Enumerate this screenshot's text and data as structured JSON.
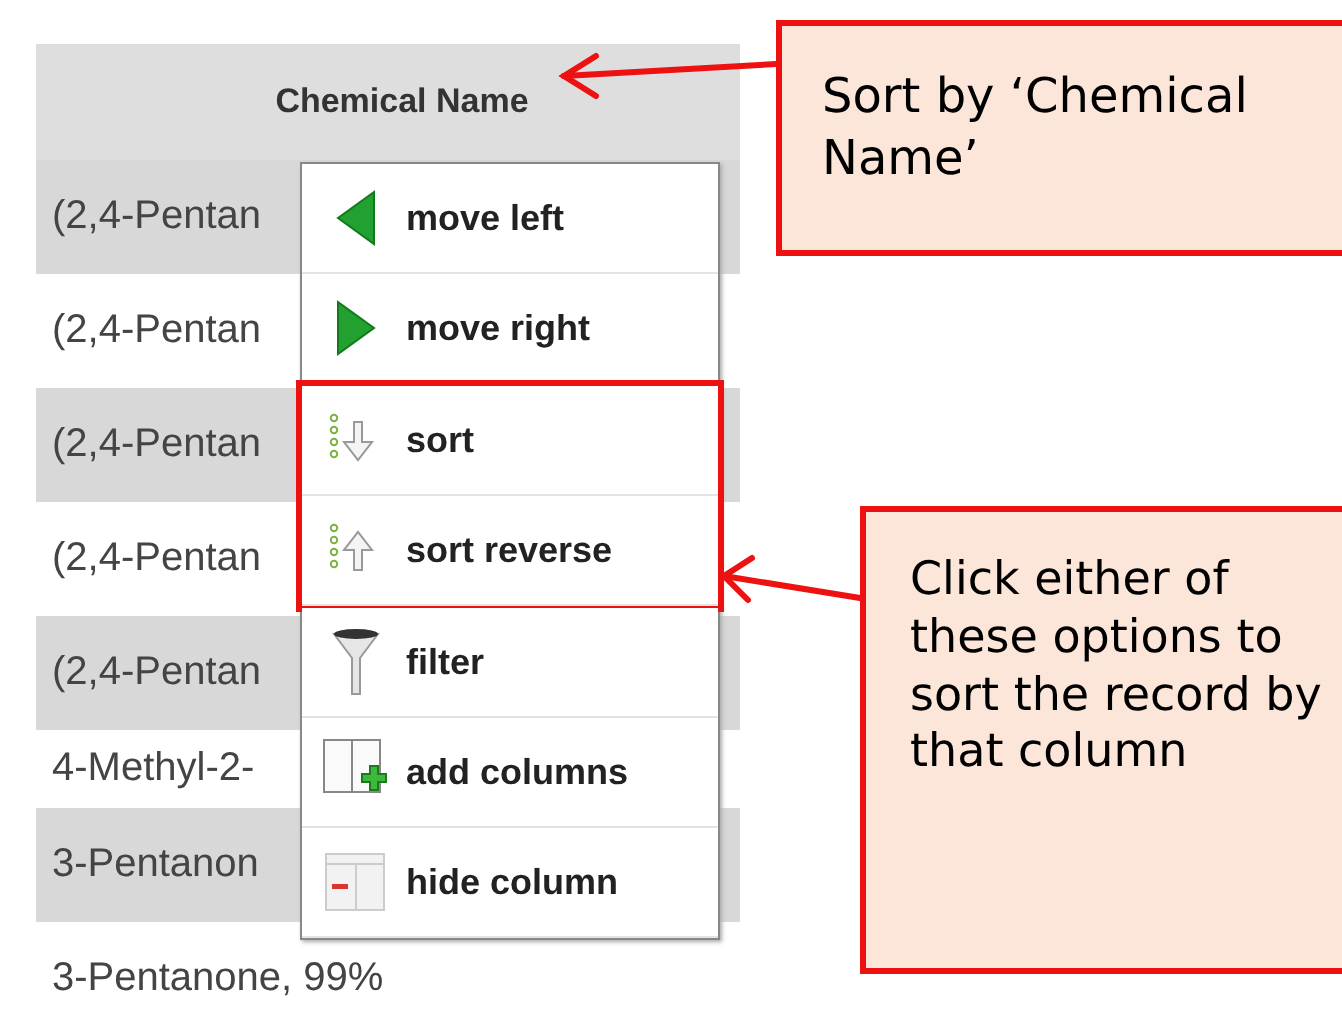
{
  "table": {
    "columns": [
      {
        "label": "Chemical Name"
      }
    ],
    "rows": [
      {
        "cells": [
          "(2,4-Pentan"
        ]
      },
      {
        "cells": [
          "(2,4-Pentan"
        ]
      },
      {
        "cells": [
          "(2,4-Pentan"
        ]
      },
      {
        "cells": [
          "(2,4-Pentan"
        ]
      },
      {
        "cells": [
          "(2,4-Pentan"
        ]
      },
      {
        "cells": [
          "4-Methyl-2-"
        ]
      },
      {
        "cells": [
          "3-Pentanon"
        ]
      },
      {
        "cells": [
          "3-Pentanone, 99%"
        ]
      }
    ]
  },
  "column_menu": {
    "items": [
      {
        "label": "move left",
        "kind": "left",
        "highlighted": false
      },
      {
        "label": "move right",
        "kind": "right",
        "highlighted": false
      },
      {
        "label": "sort",
        "kind": "sort",
        "highlighted": true
      },
      {
        "label": "sort reverse",
        "kind": "reverse",
        "highlighted": true
      },
      {
        "label": "filter",
        "kind": "filter",
        "highlighted": false
      },
      {
        "label": "add columns",
        "kind": "add",
        "highlighted": false
      },
      {
        "label": "hide column",
        "kind": "hide",
        "highlighted": false
      }
    ]
  },
  "callouts": [
    {
      "kind": "header",
      "text": "Sort by ‘Chemical Name’"
    },
    {
      "kind": "menu",
      "text": "Click either of these options to sort the record by that column"
    }
  ]
}
